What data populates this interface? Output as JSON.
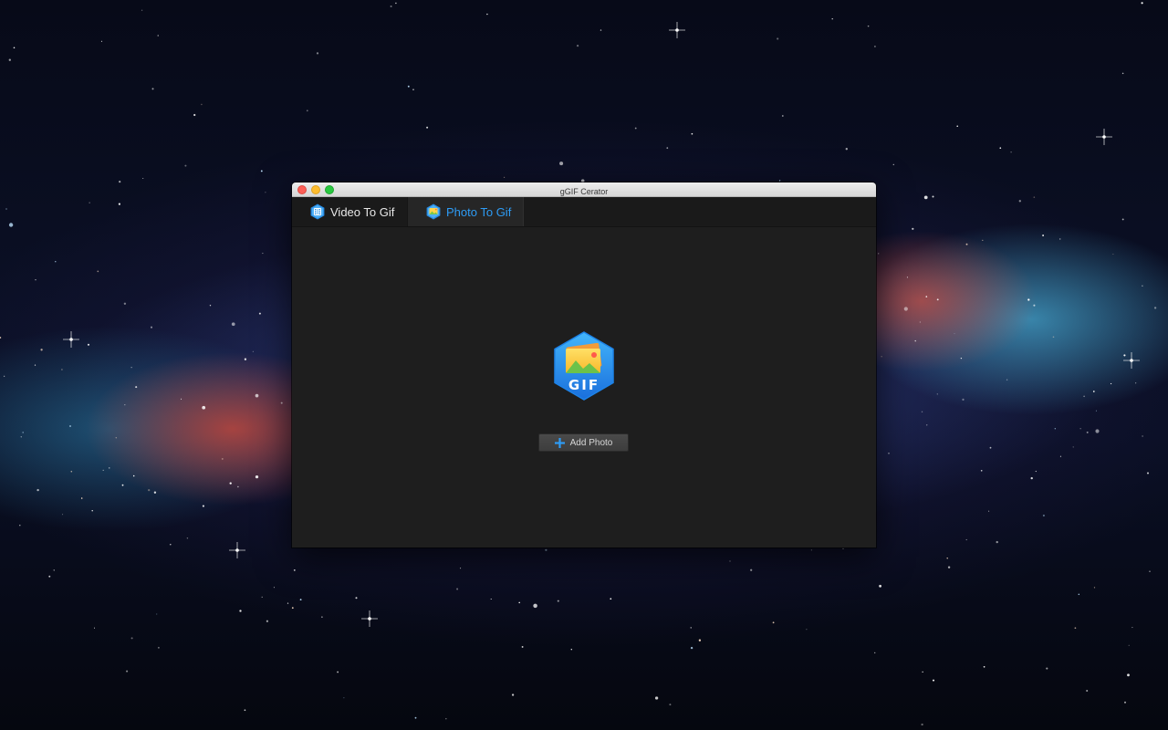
{
  "window": {
    "title": "gGIF Cerator"
  },
  "tabs": [
    {
      "label": "Video To Gif",
      "icon": "film-icon",
      "active": false
    },
    {
      "label": "Photo To Gif",
      "icon": "photo-icon",
      "active": true
    }
  ],
  "main": {
    "logo_icon": "gif-photo-logo-icon",
    "logo_text": "GIF",
    "add_button_label": "Add Photo",
    "add_button_icon": "plus-icon"
  },
  "colors": {
    "accent": "#2e9cf5",
    "window_bg": "#1e1e1e",
    "tabbar_bg": "#1a1a1a"
  }
}
